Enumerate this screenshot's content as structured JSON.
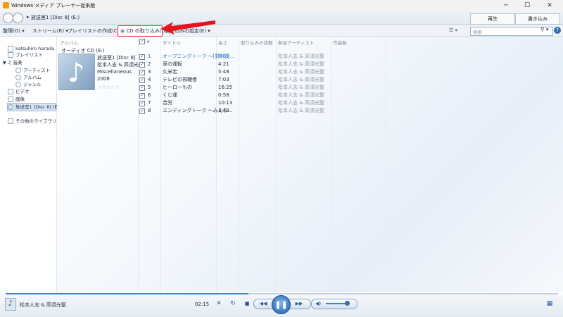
{
  "window": {
    "title": "Windows メディア プレーヤー従来版",
    "min": "─",
    "max": "☐",
    "close": "✕"
  },
  "nav": {
    "breadcrumb_arrow": "▸",
    "breadcrumb": "放送室1 [Disc 8] (E:)",
    "tabs": [
      "再生",
      "書き込み"
    ]
  },
  "toolbar": {
    "organize": "整理(O)",
    "stream": "ストリーム(R)",
    "create_playlist": "プレイリストの作成(C)",
    "rip_cd": "CD の取り込み(I)",
    "rip_settings": "取り込みの設定(E)",
    "chevron": "▾",
    "search_placeholder": "検索",
    "help": "?"
  },
  "sidebar": {
    "user": "katsuhiro harada",
    "items": [
      {
        "label": "プレイリスト"
      },
      {
        "label": "音楽"
      },
      {
        "label": "アーティスト"
      },
      {
        "label": "アルバム"
      },
      {
        "label": "ジャンル"
      },
      {
        "label": "ビデオ"
      },
      {
        "label": "画像"
      },
      {
        "label": "放送室1 [Disc 8] (E:)"
      },
      {
        "label": "その他のライブラリ"
      }
    ]
  },
  "columns": {
    "album": "アルバム",
    "num": "#",
    "title": "タイトル",
    "length": "長さ",
    "rip_status": "取り込みの状態",
    "artist": "参加アーティスト",
    "composer": "作曲者"
  },
  "group": {
    "header": "オーディオ CD (E:)"
  },
  "album": {
    "name": "放送室1 [Disc 8]",
    "artist": "松本人志 & 高須光…",
    "genre": "Miscellaneous",
    "year": "2008",
    "stars": "☆☆☆☆☆",
    "rating": 0
  },
  "tracks": [
    {
      "num": "1",
      "title": "オープニングトーク ～[野村正…",
      "length": "5:09",
      "artist": "松本人志 & 高須光聖",
      "checked": true,
      "playing": true
    },
    {
      "num": "2",
      "title": "車の運転",
      "length": "4:21",
      "artist": "松本人志 & 高須光聖",
      "checked": true
    },
    {
      "num": "3",
      "title": "久米宏",
      "length": "5:48",
      "artist": "松本人志 & 高須光聖",
      "checked": true
    },
    {
      "num": "4",
      "title": "テレビの視聴者",
      "length": "7:03",
      "artist": "松本人志 & 高須光聖",
      "checked": true
    },
    {
      "num": "5",
      "title": "ヒーローもの",
      "length": "16:25",
      "artist": "松本人志 & 高須光聖",
      "checked": true
    },
    {
      "num": "6",
      "title": "くじ運",
      "length": "0:58",
      "artist": "松本人志 & 高須光聖",
      "checked": true
    },
    {
      "num": "7",
      "title": "苦労",
      "length": "10:13",
      "artist": "松本人志 & 高須光聖",
      "checked": true
    },
    {
      "num": "8",
      "title": "エンディングトーク ～みんな…",
      "length": "3:43",
      "artist": "松本人志 & 高須光聖",
      "checked": true
    }
  ],
  "player": {
    "artist": "松本人志 & 高須光聖",
    "time": "02:15",
    "progress": 0.44,
    "volume": 0.75
  },
  "icons": {
    "note": "♪",
    "shuffle": "✕",
    "repeat": "↻",
    "stop": "■",
    "prev": "◀◀",
    "pause": "❚❚",
    "next": "▶▶",
    "volume": "◀)",
    "check": "✓",
    "grid": "▦"
  },
  "colors": {
    "accent": "#3b83d1",
    "highlight_border": "#e03030",
    "playing_text": "#2f7ac8"
  }
}
